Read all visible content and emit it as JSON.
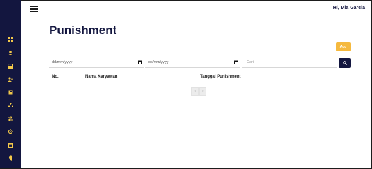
{
  "header": {
    "greeting": "Hi, Mia Garcia"
  },
  "page": {
    "title": "Punishment"
  },
  "toolbar": {
    "add_label": "Add"
  },
  "filters": {
    "date_from_placeholder": "dd/mm/yyyy",
    "date_to_placeholder": "dd/mm/yyyy",
    "search_placeholder": "Cari"
  },
  "table": {
    "columns": [
      "No.",
      "Nama Karyawan",
      "Tanggal Punishment"
    ]
  },
  "pagination": {
    "prev": "«",
    "next": "»"
  },
  "sidebar": {
    "icons": [
      "dashboard-icon",
      "users-icon",
      "inbox-icon",
      "user-settings-icon",
      "folder-icon",
      "network-icon",
      "transfer-icon",
      "settings-icon",
      "calendar-icon",
      "award-icon"
    ]
  },
  "colors": {
    "sidebar": "#13163f",
    "accent_add": "#f5b93e",
    "search_button": "#13163f",
    "icon": "#f2c84b"
  }
}
